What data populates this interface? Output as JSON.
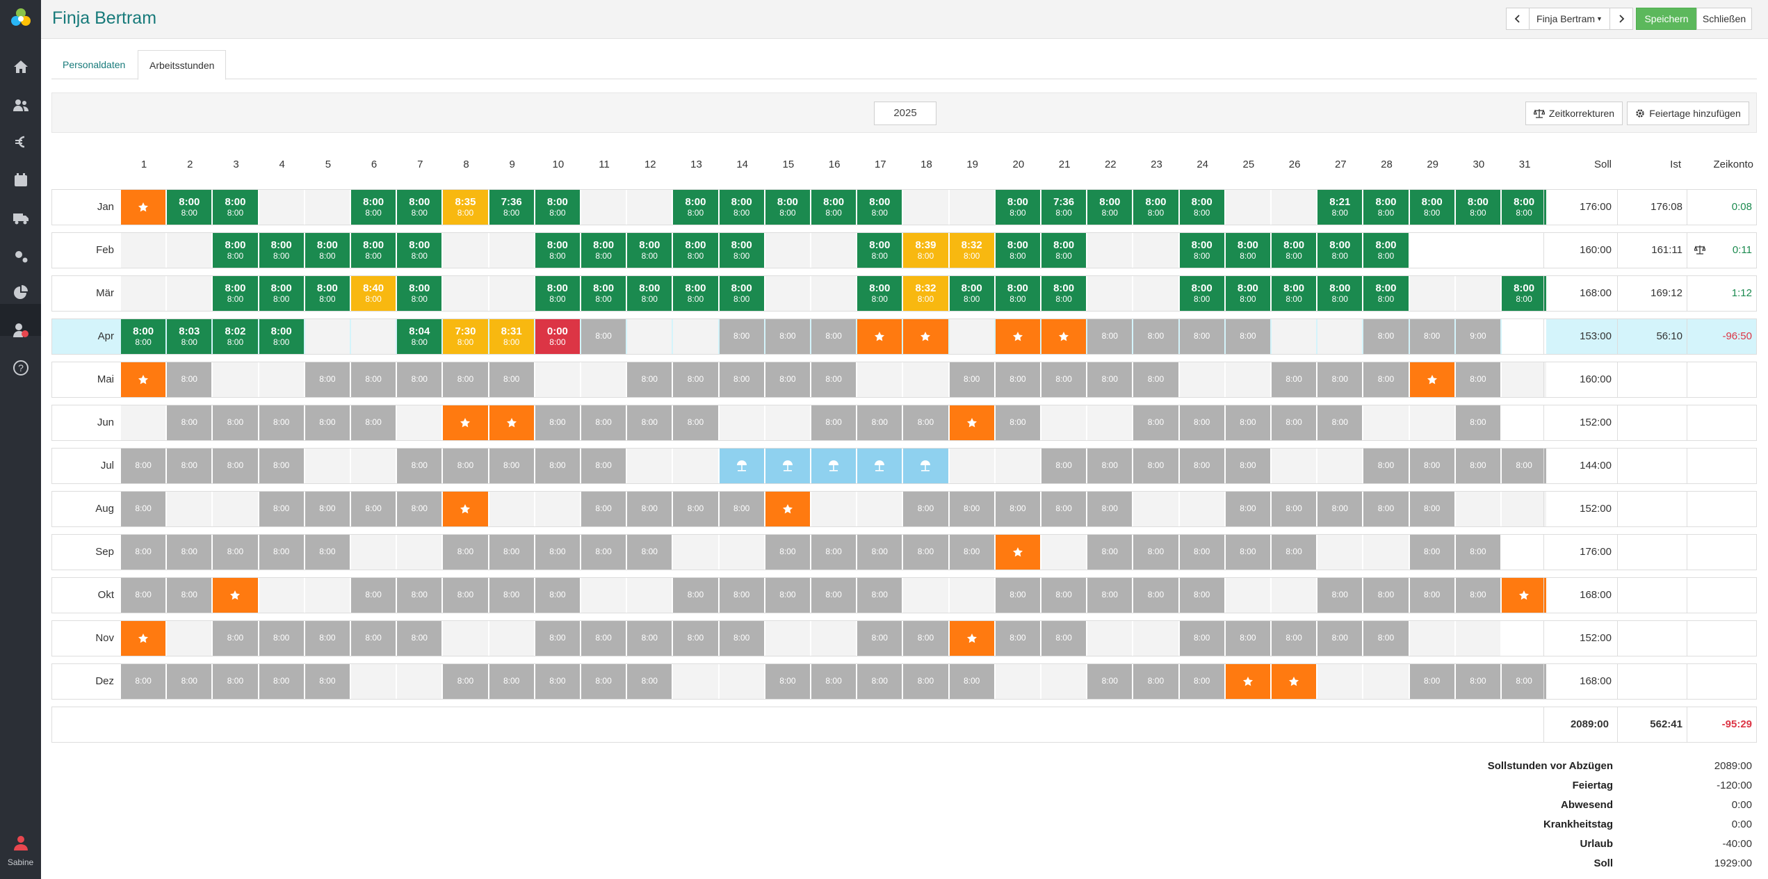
{
  "header": {
    "title": "Finja Bertram",
    "employee_select": "Finja Bertram",
    "save_label": "Speichern",
    "close_label": "Schließen"
  },
  "sidebar": {
    "items": [
      "home-icon",
      "users-icon",
      "euro-icon",
      "calendar-icon",
      "truck-icon",
      "settings-icon",
      "pie-chart-icon",
      "user-clock-icon",
      "help-icon"
    ],
    "user_name": "Sabine"
  },
  "tabs": [
    {
      "label": "Personaldaten",
      "active": false
    },
    {
      "label": "Arbeitsstunden",
      "active": true
    }
  ],
  "toolbar": {
    "year": "2025",
    "corrections_label": "Zeitkorrekturen",
    "holidays_label": "Feiertage hinzufügen"
  },
  "grid": {
    "day_headers": [
      "1",
      "2",
      "3",
      "4",
      "5",
      "6",
      "7",
      "8",
      "9",
      "10",
      "11",
      "12",
      "13",
      "14",
      "15",
      "16",
      "17",
      "18",
      "19",
      "20",
      "21",
      "22",
      "23",
      "24",
      "25",
      "26",
      "27",
      "28",
      "29",
      "30",
      "31"
    ],
    "sum_headers": {
      "soll": "Soll",
      "ist": "Ist",
      "konto": "Zeikonto"
    },
    "months": [
      {
        "name": "Jan",
        "soll": "176:00",
        "ist": "176:08",
        "konto": "0:08",
        "konto_sign": "pos",
        "cells": [
          "o",
          "g|8:00|8:00",
          "g|8:00|8:00",
          "e",
          "e",
          "g|8:00|8:00",
          "g|8:00|8:00",
          "y|8:35|8:00",
          "g|7:36|8:00",
          "g|8:00|8:00",
          "e",
          "e",
          "g|8:00|8:00",
          "g|8:00|8:00",
          "g|8:00|8:00",
          "g|8:00|8:00",
          "g|8:00|8:00",
          "e",
          "e",
          "g|8:00|8:00",
          "g|7:36|8:00",
          "g|8:00|8:00",
          "g|8:00|8:00",
          "g|8:00|8:00",
          "e",
          "e",
          "g|8:21|8:00",
          "g|8:00|8:00",
          "g|8:00|8:00",
          "g|8:00|8:00",
          "g|8:00|8:00"
        ]
      },
      {
        "name": "Feb",
        "soll": "160:00",
        "ist": "161:11",
        "konto": "0:11",
        "konto_sign": "pos",
        "konto_icon": true,
        "cells": [
          "e",
          "e",
          "g|8:00|8:00",
          "g|8:00|8:00",
          "g|8:00|8:00",
          "g|8:00|8:00",
          "g|8:00|8:00",
          "e",
          "e",
          "g|8:00|8:00",
          "g|8:00|8:00",
          "g|8:00|8:00",
          "g|8:00|8:00",
          "g|8:00|8:00",
          "e",
          "e",
          "g|8:00|8:00",
          "y|8:39|8:00",
          "y|8:32|8:00",
          "g|8:00|8:00",
          "g|8:00|8:00",
          "e",
          "e",
          "g|8:00|8:00",
          "g|8:00|8:00",
          "g|8:00|8:00",
          "g|8:00|8:00",
          "g|8:00|8:00",
          "w",
          "w",
          "w"
        ]
      },
      {
        "name": "Mär",
        "soll": "168:00",
        "ist": "169:12",
        "konto": "1:12",
        "konto_sign": "pos",
        "cells": [
          "e",
          "e",
          "g|8:00|8:00",
          "g|8:00|8:00",
          "g|8:00|8:00",
          "y|8:40|8:00",
          "g|8:00|8:00",
          "e",
          "e",
          "g|8:00|8:00",
          "g|8:00|8:00",
          "g|8:00|8:00",
          "g|8:00|8:00",
          "g|8:00|8:00",
          "e",
          "e",
          "g|8:00|8:00",
          "y|8:32|8:00",
          "g|8:00|8:00",
          "g|8:00|8:00",
          "g|8:00|8:00",
          "e",
          "e",
          "g|8:00|8:00",
          "g|8:00|8:00",
          "g|8:00|8:00",
          "g|8:00|8:00",
          "g|8:00|8:00",
          "e",
          "e",
          "g|8:00|8:00"
        ]
      },
      {
        "name": "Apr",
        "soll": "153:00",
        "ist": "56:10",
        "konto": "-96:50",
        "konto_sign": "neg",
        "highlight": true,
        "cells": [
          "g|8:00|8:00",
          "g|8:03|8:00",
          "g|8:02|8:00",
          "g|8:00|8:00",
          "e",
          "e",
          "g|8:04|8:00",
          "y|7:30|8:00",
          "y|8:31|8:00",
          "r|0:00|8:00",
          "gr|8:00",
          "e",
          "e",
          "gr|8:00",
          "gr|8:00",
          "gr|8:00",
          "o",
          "o",
          "e",
          "o",
          "o",
          "gr|8:00",
          "gr|8:00",
          "gr|8:00",
          "gr|8:00",
          "e",
          "e",
          "gr|8:00",
          "gr|8:00",
          "gr|9:00",
          "w"
        ]
      },
      {
        "name": "Mai",
        "soll": "160:00",
        "ist": "",
        "konto": "",
        "konto_sign": "",
        "cells": [
          "o",
          "gr|8:00",
          "e",
          "e",
          "gr|8:00",
          "gr|8:00",
          "gr|8:00",
          "gr|8:00",
          "gr|8:00",
          "e",
          "e",
          "gr|8:00",
          "gr|8:00",
          "gr|8:00",
          "gr|8:00",
          "gr|8:00",
          "e",
          "e",
          "gr|8:00",
          "gr|8:00",
          "gr|8:00",
          "gr|8:00",
          "gr|8:00",
          "e",
          "e",
          "gr|8:00",
          "gr|8:00",
          "gr|8:00",
          "o",
          "gr|8:00",
          "e"
        ]
      },
      {
        "name": "Jun",
        "soll": "152:00",
        "ist": "",
        "konto": "",
        "konto_sign": "",
        "cells": [
          "e",
          "gr|8:00",
          "gr|8:00",
          "gr|8:00",
          "gr|8:00",
          "gr|8:00",
          "e",
          "o",
          "o",
          "gr|8:00",
          "gr|8:00",
          "gr|8:00",
          "gr|8:00",
          "e",
          "e",
          "gr|8:00",
          "gr|8:00",
          "gr|8:00",
          "o",
          "gr|8:00",
          "e",
          "e",
          "gr|8:00",
          "gr|8:00",
          "gr|8:00",
          "gr|8:00",
          "gr|8:00",
          "e",
          "e",
          "gr|8:00",
          "w"
        ]
      },
      {
        "name": "Jul",
        "soll": "144:00",
        "ist": "",
        "konto": "",
        "konto_sign": "",
        "cells": [
          "gr|8:00",
          "gr|8:00",
          "gr|8:00",
          "gr|8:00",
          "e",
          "e",
          "gr|8:00",
          "gr|8:00",
          "gr|8:00",
          "gr|8:00",
          "gr|8:00",
          "e",
          "e",
          "b",
          "b",
          "b",
          "b",
          "b",
          "e",
          "e",
          "gr|8:00",
          "gr|8:00",
          "gr|8:00",
          "gr|8:00",
          "gr|8:00",
          "e",
          "e",
          "gr|8:00",
          "gr|8:00",
          "gr|8:00",
          "gr|8:00"
        ]
      },
      {
        "name": "Aug",
        "soll": "152:00",
        "ist": "",
        "konto": "",
        "konto_sign": "",
        "cells": [
          "gr|8:00",
          "e",
          "e",
          "gr|8:00",
          "gr|8:00",
          "gr|8:00",
          "gr|8:00",
          "o",
          "e",
          "e",
          "gr|8:00",
          "gr|8:00",
          "gr|8:00",
          "gr|8:00",
          "o",
          "e",
          "e",
          "gr|8:00",
          "gr|8:00",
          "gr|8:00",
          "gr|8:00",
          "gr|8:00",
          "e",
          "e",
          "gr|8:00",
          "gr|8:00",
          "gr|8:00",
          "gr|8:00",
          "gr|8:00",
          "e",
          "e"
        ]
      },
      {
        "name": "Sep",
        "soll": "176:00",
        "ist": "",
        "konto": "",
        "konto_sign": "",
        "cells": [
          "gr|8:00",
          "gr|8:00",
          "gr|8:00",
          "gr|8:00",
          "gr|8:00",
          "e",
          "e",
          "gr|8:00",
          "gr|8:00",
          "gr|8:00",
          "gr|8:00",
          "gr|8:00",
          "e",
          "e",
          "gr|8:00",
          "gr|8:00",
          "gr|8:00",
          "gr|8:00",
          "gr|8:00",
          "o",
          "e",
          "gr|8:00",
          "gr|8:00",
          "gr|8:00",
          "gr|8:00",
          "gr|8:00",
          "e",
          "e",
          "gr|8:00",
          "gr|8:00",
          "w"
        ]
      },
      {
        "name": "Okt",
        "soll": "168:00",
        "ist": "",
        "konto": "",
        "konto_sign": "",
        "cells": [
          "gr|8:00",
          "gr|8:00",
          "o",
          "e",
          "e",
          "gr|8:00",
          "gr|8:00",
          "gr|8:00",
          "gr|8:00",
          "gr|8:00",
          "e",
          "e",
          "gr|8:00",
          "gr|8:00",
          "gr|8:00",
          "gr|8:00",
          "gr|8:00",
          "e",
          "e",
          "gr|8:00",
          "gr|8:00",
          "gr|8:00",
          "gr|8:00",
          "gr|8:00",
          "e",
          "e",
          "gr|8:00",
          "gr|8:00",
          "gr|8:00",
          "gr|8:00",
          "o"
        ]
      },
      {
        "name": "Nov",
        "soll": "152:00",
        "ist": "",
        "konto": "",
        "konto_sign": "",
        "cells": [
          "o",
          "e",
          "gr|8:00",
          "gr|8:00",
          "gr|8:00",
          "gr|8:00",
          "gr|8:00",
          "e",
          "e",
          "gr|8:00",
          "gr|8:00",
          "gr|8:00",
          "gr|8:00",
          "gr|8:00",
          "e",
          "e",
          "gr|8:00",
          "gr|8:00",
          "o",
          "gr|8:00",
          "gr|8:00",
          "e",
          "e",
          "gr|8:00",
          "gr|8:00",
          "gr|8:00",
          "gr|8:00",
          "gr|8:00",
          "e",
          "e",
          "w"
        ]
      },
      {
        "name": "Dez",
        "soll": "168:00",
        "ist": "",
        "konto": "",
        "konto_sign": "",
        "cells": [
          "gr|8:00",
          "gr|8:00",
          "gr|8:00",
          "gr|8:00",
          "gr|8:00",
          "e",
          "e",
          "gr|8:00",
          "gr|8:00",
          "gr|8:00",
          "gr|8:00",
          "gr|8:00",
          "e",
          "e",
          "gr|8:00",
          "gr|8:00",
          "gr|8:00",
          "gr|8:00",
          "gr|8:00",
          "e",
          "e",
          "gr|8:00",
          "gr|8:00",
          "gr|8:00",
          "o",
          "o",
          "e",
          "e",
          "gr|8:00",
          "gr|8:00",
          "gr|8:00"
        ]
      }
    ],
    "totals": {
      "soll": "2089:00",
      "ist": "562:41",
      "konto": "-95:29"
    }
  },
  "summary": [
    {
      "label": "Sollstunden vor Abzügen",
      "value": "2089:00"
    },
    {
      "label": "Feiertag",
      "value": "-120:00"
    },
    {
      "label": "Abwesend",
      "value": "0:00"
    },
    {
      "label": "Krankheitstag",
      "value": "0:00"
    },
    {
      "label": "Urlaub",
      "value": "-40:00"
    },
    {
      "label": "Soll",
      "value": "1929:00"
    }
  ],
  "colors": {
    "worked": "#1b8a4f",
    "overtime": "#f8b810",
    "missing": "#dc3545",
    "holiday": "#ff7a10",
    "planned": "#b1b1b1",
    "vacation": "#8fd1ef",
    "title": "#177a7a"
  }
}
